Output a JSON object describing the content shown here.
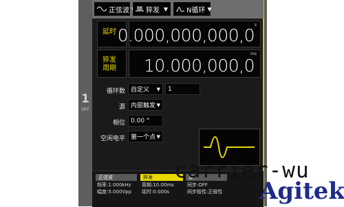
{
  "mode_buttons": [
    {
      "label": "正弦波",
      "icon": "sine-wave-icon"
    },
    {
      "label": "猝发",
      "icon": "burst-icon"
    },
    {
      "label": "N循环",
      "icon": "n-cycle-icon"
    }
  ],
  "delay": {
    "label": "延时",
    "value": "0.000,000,000,0",
    "unit": "s"
  },
  "burst_period": {
    "label_line1": "猝发",
    "label_line2": "周期",
    "value": "10.000,000,0",
    "unit": "ms"
  },
  "cycles": {
    "label": "循环数",
    "mode": "自定义",
    "value": "1"
  },
  "source": {
    "label": "源",
    "value": "内部触发"
  },
  "phase": {
    "label": "相位",
    "value": "0.00 °"
  },
  "idle_level": {
    "label": "空闲电平",
    "value": "第一个点"
  },
  "channel": {
    "number": "1",
    "state": "OFF"
  },
  "status_tabs": {
    "sine": {
      "title": "正弦波",
      "line1": "频率:1.000kHz",
      "line2": "幅度:5.000Vpp"
    },
    "burst": {
      "title": "猝发",
      "line1": "周期:10.00ms",
      "line2": "延时:0.000s"
    },
    "source": {
      "title": "源",
      "line1": "同步:OFF",
      "line2": "同步极性:正极性"
    }
  },
  "watermarks": {
    "text1": "carrier-wu",
    "text2": "Agitek"
  },
  "colors": {
    "accent": "#e8d800",
    "panel": "#5e5e5e",
    "screen": "#1a1a1a"
  }
}
